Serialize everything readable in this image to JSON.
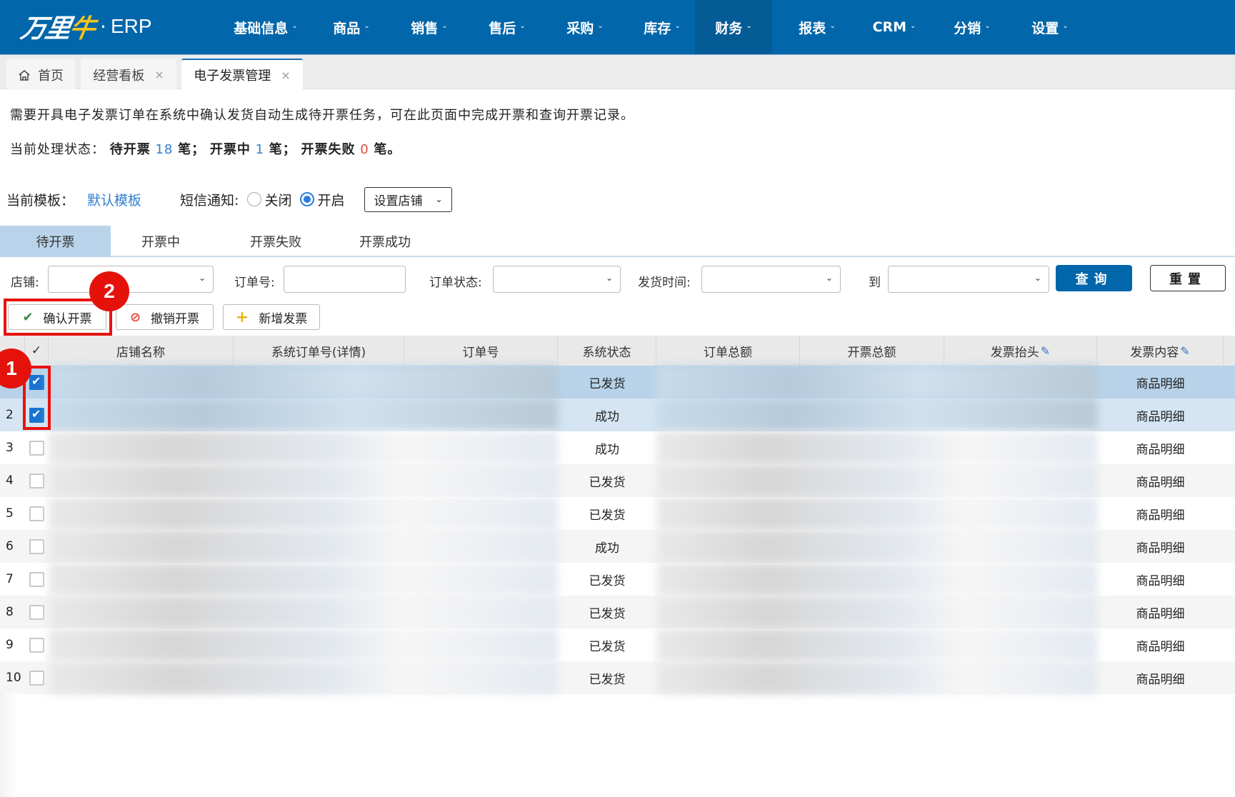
{
  "app": {
    "logo_text": "万里牛",
    "logo_suffix": "ERP",
    "brand_color": "#0266aa"
  },
  "nav": {
    "items": [
      {
        "label": "基础信息"
      },
      {
        "label": "商品"
      },
      {
        "label": "销售"
      },
      {
        "label": "售后"
      },
      {
        "label": "采购"
      },
      {
        "label": "库存"
      },
      {
        "label": "财务",
        "active": true
      },
      {
        "label": "报表"
      },
      {
        "label": "CRM"
      },
      {
        "label": "分销"
      },
      {
        "label": "设置"
      }
    ]
  },
  "page_tabs": [
    {
      "label": "首页",
      "icon": "home-icon"
    },
    {
      "label": "经营看板",
      "closable": true
    },
    {
      "label": "电子发票管理",
      "closable": true,
      "active": true
    }
  ],
  "description": "需要开具电子发票订单在系统中确认发货自动生成待开票任务，可在此页面中完成开票和查询开票记录。",
  "status": {
    "label": "当前处理状态：",
    "pending_label": "待开票",
    "pending_count": "18",
    "processing_label": "开票中",
    "processing_count": "1",
    "failed_label": "开票失败",
    "failed_count": "0",
    "unit": "笔；",
    "unit_end": "笔。"
  },
  "template": {
    "label": "当前模板：",
    "value": "默认模板",
    "sms_label": "短信通知:",
    "sms_off": "关闭",
    "sms_on": "开启",
    "sms_selected": "开启",
    "store_setting": "设置店铺"
  },
  "sub_tabs": [
    {
      "label": "待开票",
      "active": true
    },
    {
      "label": "开票中"
    },
    {
      "label": "开票失败"
    },
    {
      "label": "开票成功"
    }
  ],
  "filters": {
    "store_label": "店铺:",
    "store_value": "",
    "order_no_label": "订单号:",
    "order_no_value": "",
    "order_status_label": "订单状态:",
    "order_status_value": "",
    "ship_time_label": "发货时间:",
    "ship_time_from": "",
    "to_label": "到",
    "ship_time_to": "",
    "query_label": "查询",
    "reset_label": "重置"
  },
  "actions": {
    "confirm": "确认开票",
    "cancel": "撤销开票",
    "add": "新增发票"
  },
  "table": {
    "columns": [
      "",
      "✓",
      "店铺名称",
      "系统订单号(详情)",
      "订单号",
      "系统状态",
      "订单总额",
      "开票总额",
      "发票抬头",
      "发票内容"
    ],
    "rows": [
      {
        "index": "1",
        "checked": true,
        "status": "已发货",
        "content": "商品明细"
      },
      {
        "index": "2",
        "checked": true,
        "status": "成功",
        "content": "商品明细"
      },
      {
        "index": "3",
        "checked": false,
        "status": "成功",
        "content": "商品明细"
      },
      {
        "index": "4",
        "checked": false,
        "status": "已发货",
        "content": "商品明细"
      },
      {
        "index": "5",
        "checked": false,
        "status": "已发货",
        "content": "商品明细"
      },
      {
        "index": "6",
        "checked": false,
        "status": "成功",
        "content": "商品明细"
      },
      {
        "index": "7",
        "checked": false,
        "status": "已发货",
        "content": "商品明细"
      },
      {
        "index": "8",
        "checked": false,
        "status": "已发货",
        "content": "商品明细"
      },
      {
        "index": "9",
        "checked": false,
        "status": "已发货",
        "content": "商品明细"
      },
      {
        "index": "10",
        "checked": false,
        "status": "已发货",
        "content": "商品明细"
      }
    ]
  },
  "annotations": [
    {
      "number": "1",
      "target": "row-checkboxes"
    },
    {
      "number": "2",
      "target": "confirm-invoice-button"
    }
  ]
}
